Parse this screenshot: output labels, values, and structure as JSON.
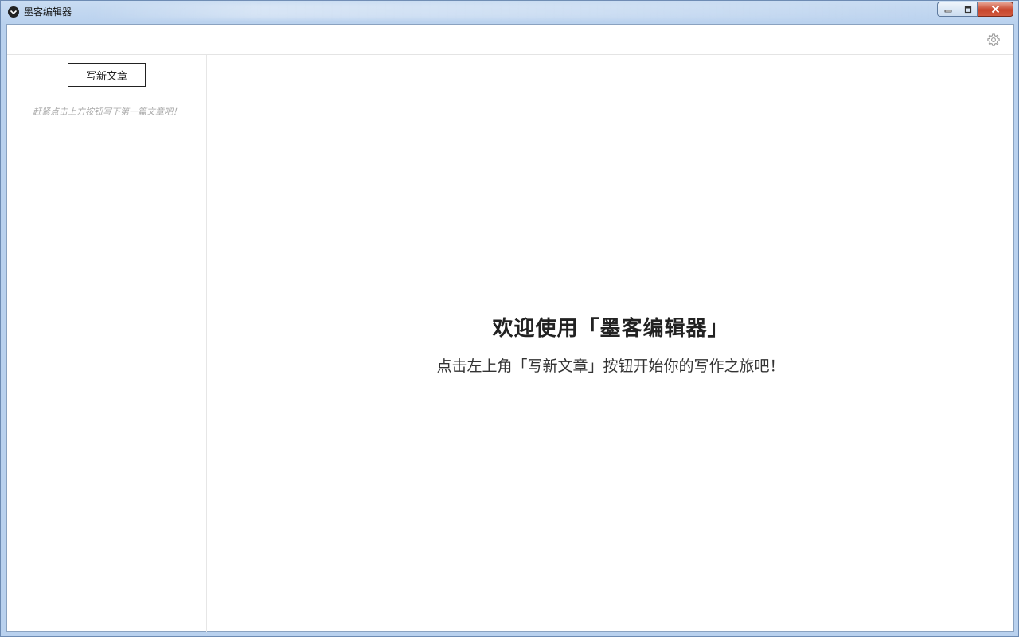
{
  "window": {
    "title": "墨客编辑器"
  },
  "toolbar": {
    "settings_icon": "gear-icon"
  },
  "sidebar": {
    "new_article_label": "写新文章",
    "empty_hint": "赶紧点击上方按钮写下第一篇文章吧！"
  },
  "main": {
    "welcome_title": "欢迎使用「墨客编辑器」",
    "welcome_subtitle": "点击左上角「写新文章」按钮开始你的写作之旅吧！"
  },
  "colors": {
    "text_primary": "#222222",
    "hint": "#aaaaaa",
    "close_button": "#c7452b"
  }
}
